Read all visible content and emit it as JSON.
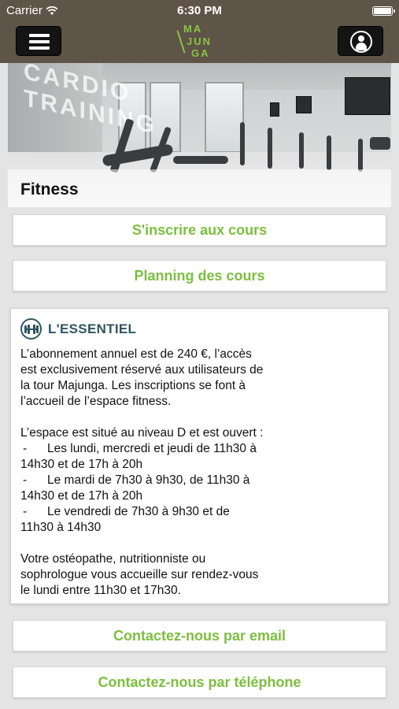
{
  "status_bar": {
    "carrier": "Carrier",
    "time": "6:30 PM"
  },
  "nav": {
    "logo_lines": [
      "MA",
      "JUN",
      "GA"
    ]
  },
  "hero": {
    "title": "Fitness",
    "wall_text": "CARDIO TRAINING"
  },
  "buttons": {
    "register": "S'inscrire aux cours",
    "planning": "Planning des cours",
    "email": "Contactez-nous par email",
    "phone": "Contactez-nous par téléphone"
  },
  "essentiel": {
    "title": "L'ESSENTIEL",
    "intro_lines": [
      "L’abonnement annuel est de 240 €, l’accès",
      "est exclusivement réservé aux utilisateurs de",
      "la tour Majunga. Les inscriptions se font à",
      "l’accueil de l’espace fitness."
    ],
    "hours_intro": "L’espace est situé au niveau D et est ouvert :",
    "schedule": [
      {
        "dash": "-",
        "line1": "Les lundi, mercredi et jeudi de 11h30 à",
        "line2": "14h30 et de 17h à 20h"
      },
      {
        "dash": "-",
        "line1": "Le mardi de 7h30 à 9h30, de 11h30 à",
        "line2": "14h30 et de 17h à 20h"
      },
      {
        "dash": "-",
        "line1": "Le vendredi de 7h30 à 9h30 et de",
        "line2": "11h30 à 14h30"
      }
    ],
    "outro_lines": [
      "Votre ostéopathe, nutritionniste ou",
      "sophrologue vous accueille sur rendez-vous",
      "le lundi entre 11h30 et 17h30."
    ]
  },
  "colors": {
    "brand_bar": "#5f5448",
    "accent_green": "#7cbf3f",
    "heading_teal": "#2f5560"
  },
  "icons": [
    "wifi-icon",
    "battery-icon",
    "menu-icon",
    "user-icon",
    "dumbbell-icon"
  ]
}
